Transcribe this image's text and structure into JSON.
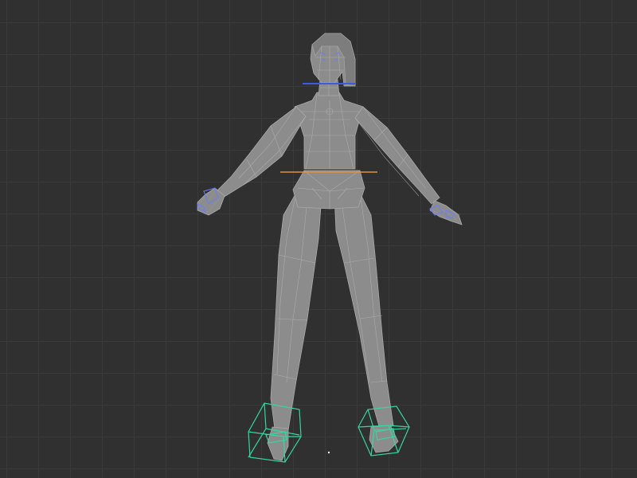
{
  "viewport": {
    "background_color": "#303030",
    "grid_color": "#3a3a3a"
  },
  "model": {
    "mesh_color": "#8c8c8c",
    "wire_color": "#b6b6b6"
  },
  "controls": {
    "foot_controller_color": "#35d6a0",
    "hip_controller_color": "#e0913a",
    "head_controller_color": "#3d5be0",
    "hand_controller_color": "#6a7cff"
  }
}
